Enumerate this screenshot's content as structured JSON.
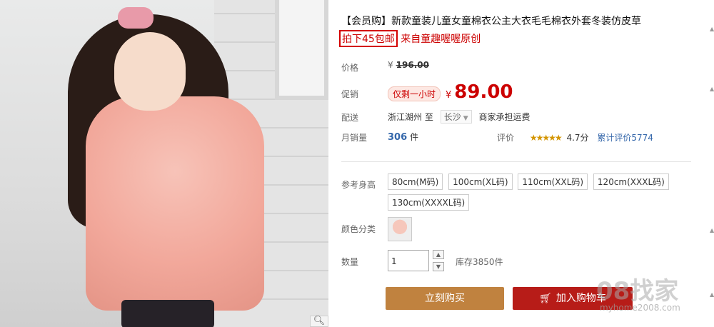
{
  "product": {
    "title": "【会员购】新款童装儿童女童棉衣公主大衣毛毛棉衣外套冬装仿皮草",
    "promo_boxed": "拍下45包邮",
    "promo_rest": "来自童趣喔喔原创"
  },
  "labels": {
    "price": "价格",
    "promo": "促销",
    "shipping": "配送",
    "monthly_sales": "月销量",
    "size": "参考身高",
    "color": "颜色分类",
    "quantity": "数量"
  },
  "price": {
    "currency": "¥",
    "original": "196.00",
    "promo_badge": "仅剩一小时",
    "current": "89.00"
  },
  "shipping": {
    "from": "浙江湖州",
    "to_word": "至",
    "destination": "长沙",
    "note": "商家承担运费"
  },
  "sales": {
    "count": "306",
    "unit": "件",
    "review_label": "评价",
    "stars": "★★★★★",
    "score": "4.7分",
    "review_count": "累计评价5774"
  },
  "sizes": [
    "80cm(M码)",
    "100cm(XL码)",
    "110cm(XXL码)",
    "120cm(XXXL码)",
    "130cm(XXXXL码)"
  ],
  "quantity": {
    "value": "1",
    "stock": "库存3850件"
  },
  "buttons": {
    "buy": "立刻购买",
    "add_to_cart": "加入购物车"
  },
  "watermark": {
    "main": "08找家",
    "url": "myhome2008.com"
  },
  "colors": {
    "price_red": "#cc0000",
    "buy_button": "#c0823f",
    "cart_button": "#b71c18"
  }
}
